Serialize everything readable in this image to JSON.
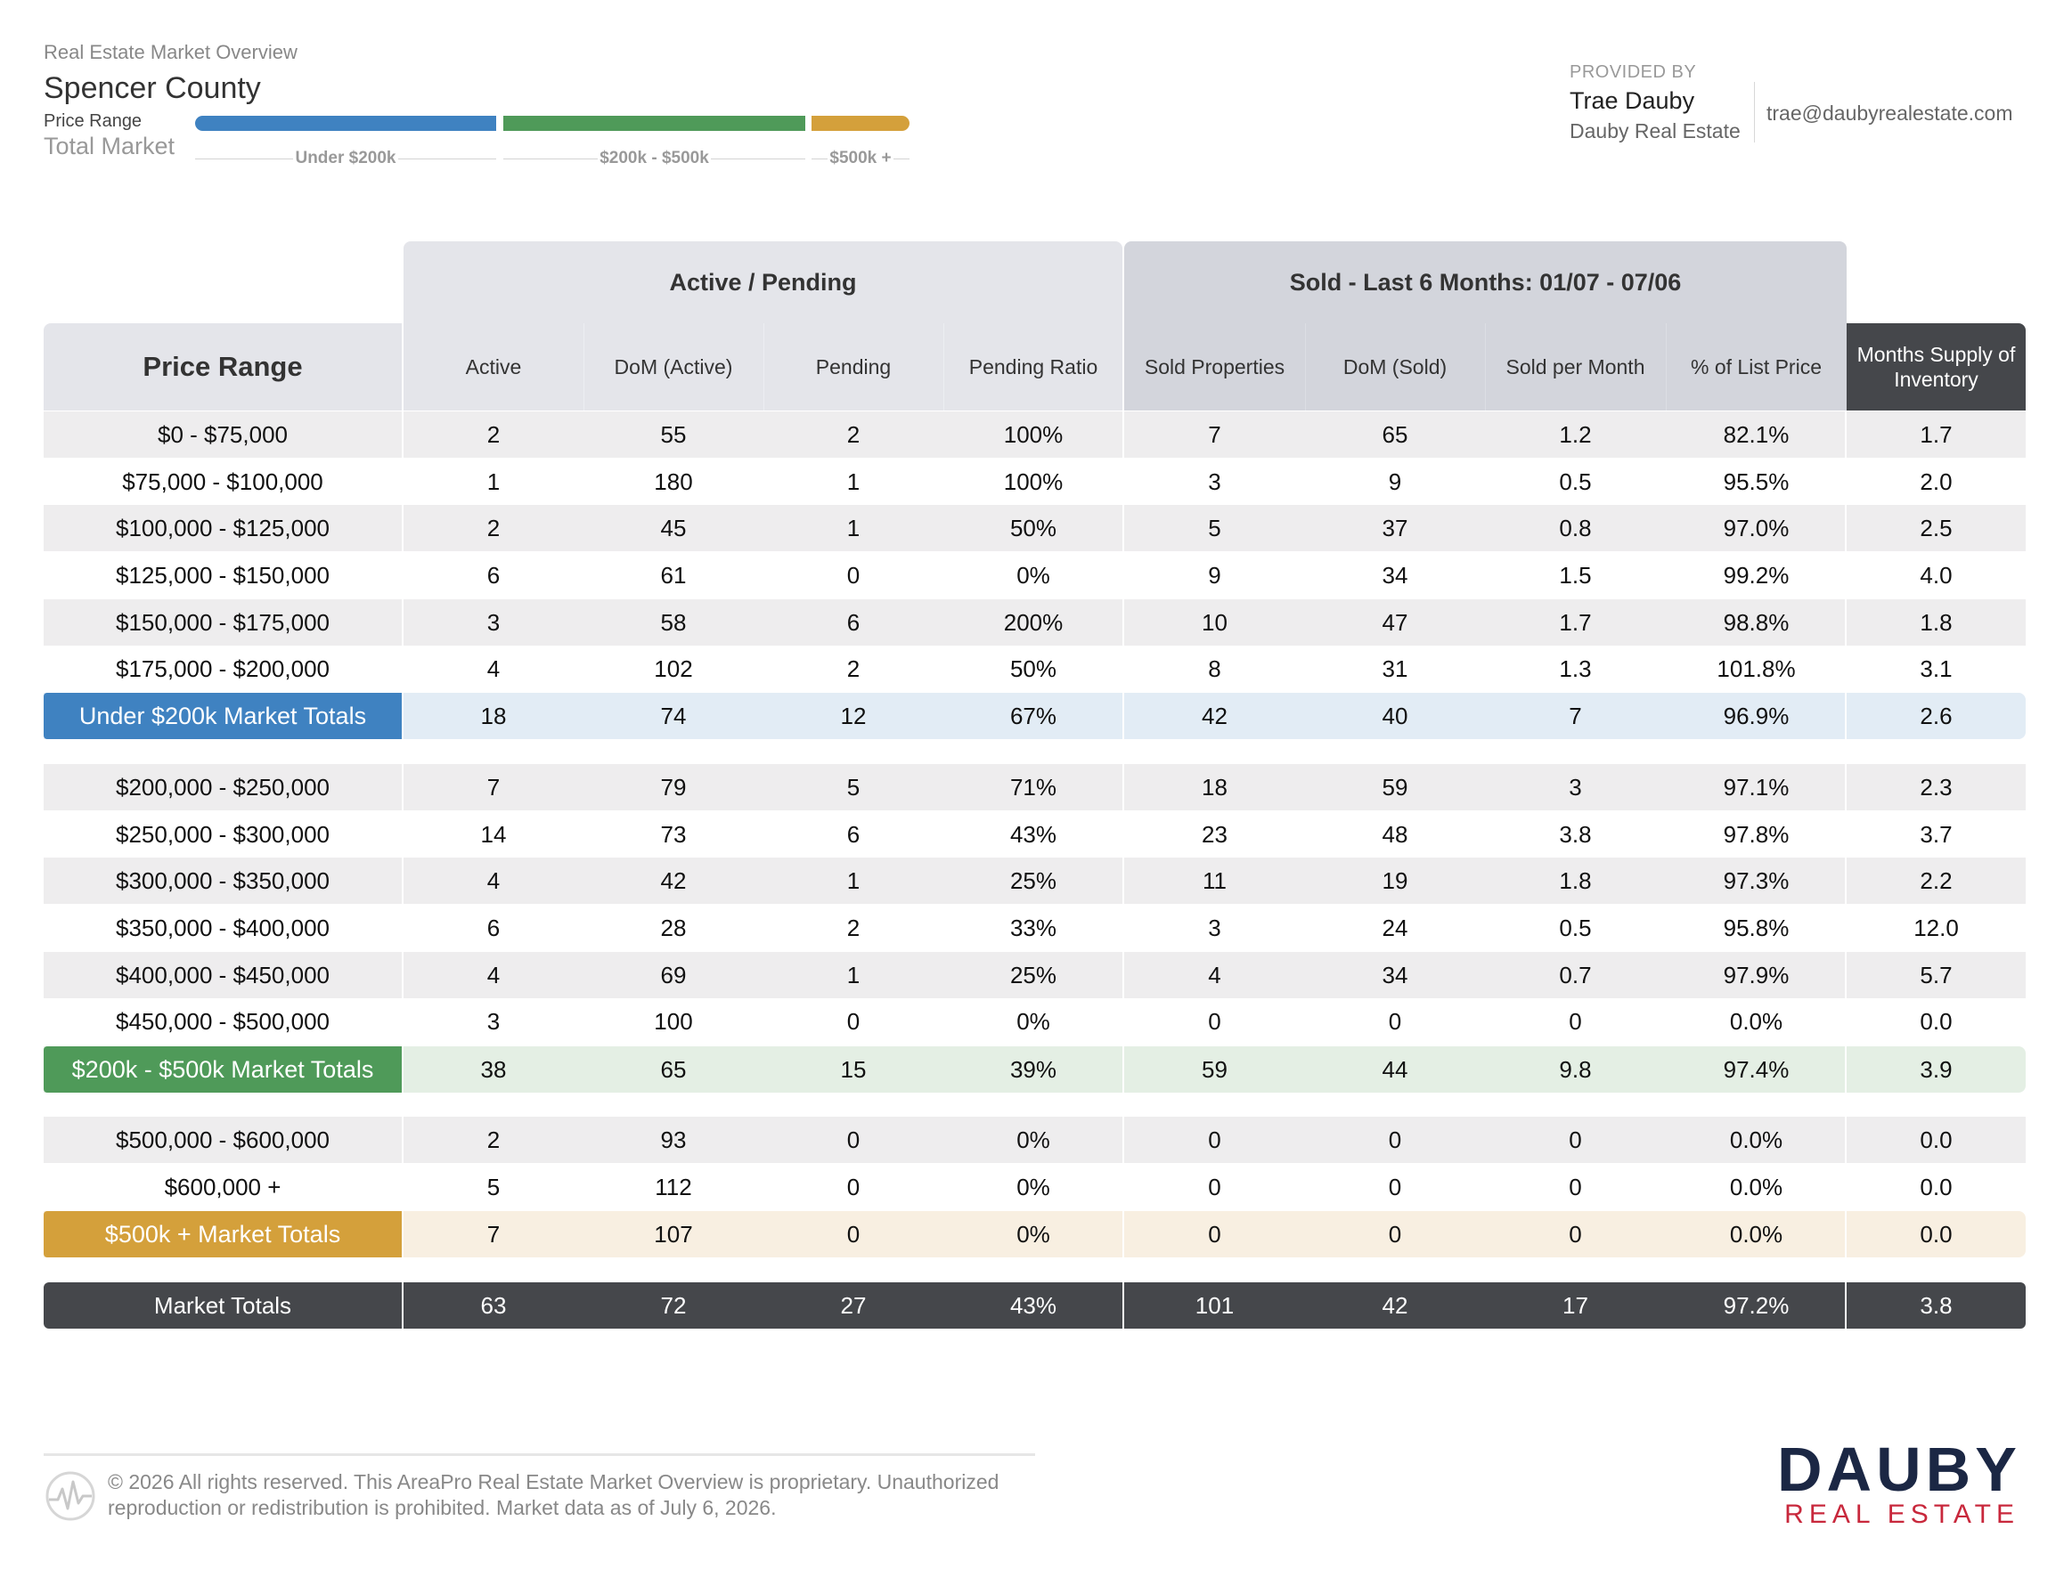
{
  "header": {
    "subtitle": "Real Estate Market Overview",
    "county": "Spencer County",
    "price_range_label": "Price Range",
    "total_market_label": "Total Market",
    "segments": [
      {
        "label": "Under $200k",
        "color": "#3f82c1"
      },
      {
        "label": "$200k - $500k",
        "color": "#4f9a59"
      },
      {
        "label": "$500k +",
        "color": "#d4a03b"
      }
    ]
  },
  "provider": {
    "label": "PROVIDED BY",
    "name": "Trae Dauby",
    "company": "Dauby Real Estate",
    "email": "trae@daubyrealestate.com"
  },
  "table": {
    "group_active": "Active / Pending",
    "group_sold": "Sold - Last 6 Months: 01/07 - 07/06",
    "price_range_header": "Price Range",
    "months_supply_header": "Months Supply of Inventory",
    "columns": [
      "Active",
      "DoM (Active)",
      "Pending",
      "Pending Ratio",
      "Sold Properties",
      "DoM (Sold)",
      "Sold per Month",
      "% of List Price"
    ],
    "rows": [
      [
        "$0 - $75,000",
        "2",
        "55",
        "2",
        "100%",
        "7",
        "65",
        "1.2",
        "82.1%",
        "1.7"
      ],
      [
        "$75,000 - $100,000",
        "1",
        "180",
        "1",
        "100%",
        "3",
        "9",
        "0.5",
        "95.5%",
        "2.0"
      ],
      [
        "$100,000 - $125,000",
        "2",
        "45",
        "1",
        "50%",
        "5",
        "37",
        "0.8",
        "97.0%",
        "2.5"
      ],
      [
        "$125,000 - $150,000",
        "6",
        "61",
        "0",
        "0%",
        "9",
        "34",
        "1.5",
        "99.2%",
        "4.0"
      ],
      [
        "$150,000 - $175,000",
        "3",
        "58",
        "6",
        "200%",
        "10",
        "47",
        "1.7",
        "98.8%",
        "1.8"
      ],
      [
        "$175,000 - $200,000",
        "4",
        "102",
        "2",
        "50%",
        "8",
        "31",
        "1.3",
        "101.8%",
        "3.1"
      ],
      [
        "Under $200k Market Totals",
        "18",
        "74",
        "12",
        "67%",
        "42",
        "40",
        "7",
        "96.9%",
        "2.6"
      ],
      [
        "$200,000 - $250,000",
        "7",
        "79",
        "5",
        "71%",
        "18",
        "59",
        "3",
        "97.1%",
        "2.3"
      ],
      [
        "$250,000 - $300,000",
        "14",
        "73",
        "6",
        "43%",
        "23",
        "48",
        "3.8",
        "97.8%",
        "3.7"
      ],
      [
        "$300,000 - $350,000",
        "4",
        "42",
        "1",
        "25%",
        "11",
        "19",
        "1.8",
        "97.3%",
        "2.2"
      ],
      [
        "$350,000 - $400,000",
        "6",
        "28",
        "2",
        "33%",
        "3",
        "24",
        "0.5",
        "95.8%",
        "12.0"
      ],
      [
        "$400,000 - $450,000",
        "4",
        "69",
        "1",
        "25%",
        "4",
        "34",
        "0.7",
        "97.9%",
        "5.7"
      ],
      [
        "$450,000 - $500,000",
        "3",
        "100",
        "0",
        "0%",
        "0",
        "0",
        "0",
        "0.0%",
        "0.0"
      ],
      [
        "$200k - $500k Market Totals",
        "38",
        "65",
        "15",
        "39%",
        "59",
        "44",
        "9.8",
        "97.4%",
        "3.9"
      ],
      [
        "$500,000 - $600,000",
        "2",
        "93",
        "0",
        "0%",
        "0",
        "0",
        "0",
        "0.0%",
        "0.0"
      ],
      [
        "$600,000 +",
        "5",
        "112",
        "0",
        "0%",
        "0",
        "0",
        "0",
        "0.0%",
        "0.0"
      ],
      [
        "$500k + Market Totals",
        "7",
        "107",
        "0",
        "0%",
        "0",
        "0",
        "0",
        "0.0%",
        "0.0"
      ],
      [
        "Market Totals",
        "63",
        "72",
        "27",
        "43%",
        "101",
        "42",
        "17",
        "97.2%",
        "3.8"
      ]
    ]
  },
  "footer": {
    "text": "© 2026 All rights reserved. This AreaPro Real Estate Market Overview is proprietary. Unauthorized reproduction or redistribution is prohibited. Market data as of July 6, 2026.",
    "brand_top": "DAUBY",
    "brand_bottom": "REAL ESTATE"
  }
}
